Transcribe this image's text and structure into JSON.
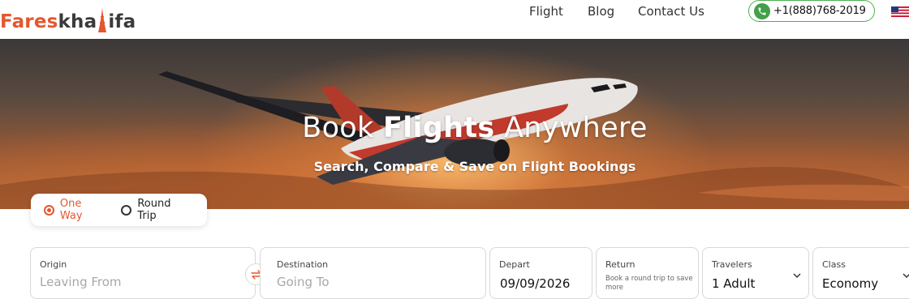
{
  "header": {
    "logo": {
      "part_a": "Fares",
      "part_b": "kha",
      "part_c": "ifa"
    },
    "nav": [
      {
        "label": "Flight"
      },
      {
        "label": "Blog"
      },
      {
        "label": "Contact Us"
      }
    ],
    "phone": "+1(888)768-2019",
    "flag_icon": "us-flag-icon"
  },
  "hero": {
    "title_pre": "Book ",
    "title_bold": "Flights",
    "title_post": " Anywhere",
    "subtitle": "Search, Compare & Save on Flight Bookings"
  },
  "booking": {
    "trip_types": [
      {
        "label": "One Way",
        "selected": true
      },
      {
        "label": "Round Trip",
        "selected": false
      }
    ],
    "origin": {
      "label": "Origin",
      "placeholder": "Leaving From"
    },
    "destination": {
      "label": "Destination",
      "placeholder": "Going To"
    },
    "depart": {
      "label": "Depart",
      "value": "09/09/2026"
    },
    "return": {
      "label": "Return",
      "note": "Book a round trip to save more"
    },
    "travelers": {
      "label": "Travelers",
      "value": "1 Adult"
    },
    "class": {
      "label": "Class",
      "value": "Economy"
    }
  },
  "colors": {
    "brand_orange": "#e4572e",
    "phone_green": "#43a047",
    "text_dark": "#333333"
  }
}
